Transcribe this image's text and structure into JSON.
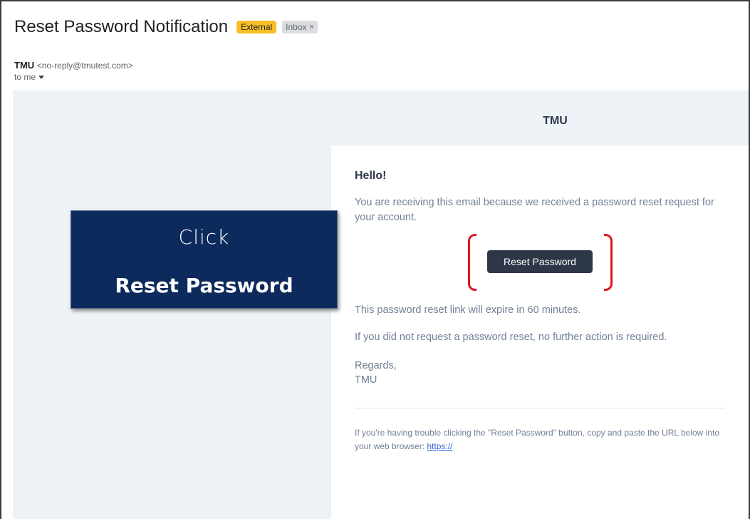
{
  "subject": {
    "title": "Reset Password Notification",
    "badge_external": "External",
    "badge_inbox": "Inbox",
    "badge_inbox_close": "×"
  },
  "sender": {
    "name": "TMU",
    "email": "<no-reply@tmutest.com>",
    "recipient": "to me"
  },
  "email": {
    "brand": "TMU",
    "greeting": "Hello!",
    "intro": "You are receiving this email because we received a password reset request for your account.",
    "button_label": "Reset Password",
    "expire_text": "This password reset link will expire in 60 minutes.",
    "no_action_text": "If you did not request a password reset, no further action is required.",
    "regards": "Regards,",
    "signature": "TMU",
    "trouble_text": "If you're having trouble clicking the \"Reset Password\" button, copy and paste the URL below into your web browser: ",
    "trouble_link": "https://"
  },
  "callout": {
    "line1": "Click",
    "line2": "Reset Password"
  },
  "colors": {
    "badge_external": "#f6bf26",
    "button_bg": "#2d3748",
    "email_bg": "#edf2f7",
    "callout_bg": "#0d2a5c",
    "highlight_bracket": "#e0141e",
    "link": "#3869d4"
  }
}
